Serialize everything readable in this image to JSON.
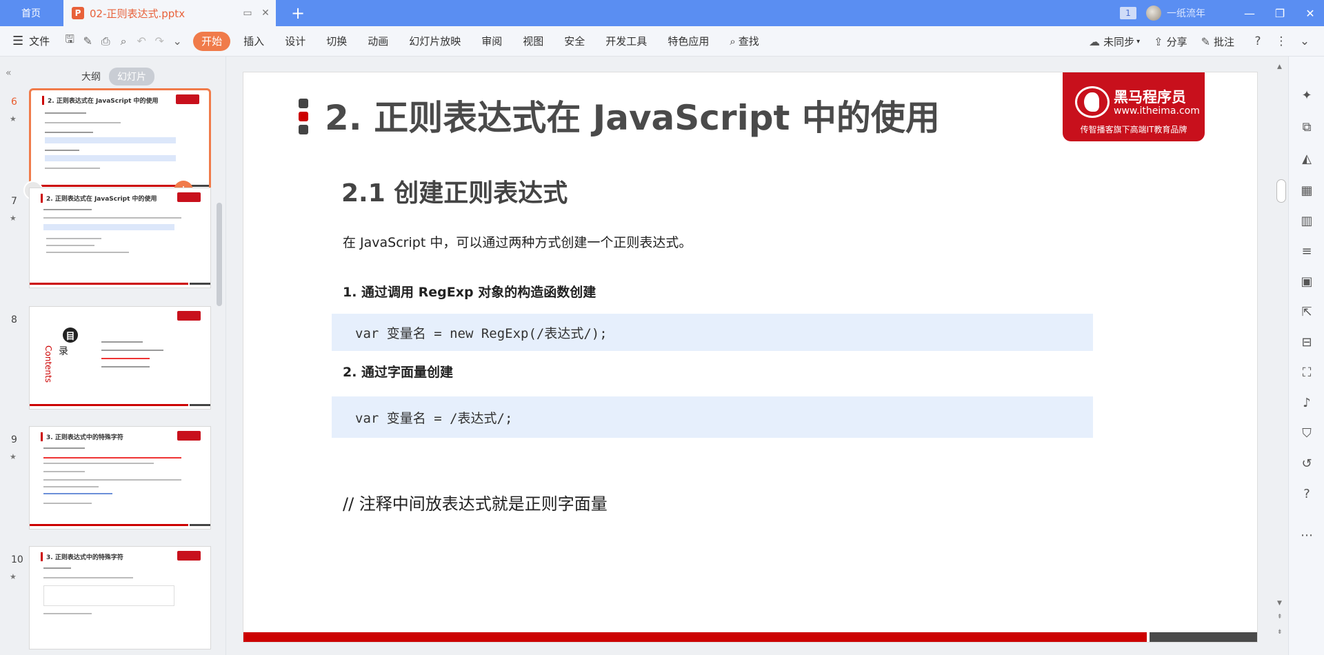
{
  "titlebar": {
    "home_tab": "首页",
    "doc_tab_icon": "P",
    "doc_tab": "02-正则表达式.pptx",
    "page_badge": "1",
    "user_name": "一纸流年"
  },
  "ribbon": {
    "file_label": "文件",
    "tabs": [
      "开始",
      "插入",
      "设计",
      "切换",
      "动画",
      "幻灯片放映",
      "审阅",
      "视图",
      "安全",
      "开发工具",
      "特色应用"
    ],
    "search_label": "查找",
    "sync_label": "未同步",
    "share_label": "分享",
    "comment_label": "批注"
  },
  "panel": {
    "outline_label": "大纲",
    "slides_label": "幻灯片",
    "thumbnails": [
      {
        "num": "6",
        "title": "2. 正则表达式在 JavaScript 中的使用"
      },
      {
        "num": "7",
        "title": "2. 正则表达式在 JavaScript 中的使用"
      },
      {
        "num": "8",
        "title": ""
      },
      {
        "num": "9",
        "title": "3. 正则表达式中的特殊字符"
      },
      {
        "num": "10",
        "title": "3. 正则表达式中的特殊字符"
      }
    ],
    "toc_title_char": "目",
    "toc_sub_char": "录",
    "toc_contents": "Contents"
  },
  "slide": {
    "title": "2. 正则表达式在 JavaScript 中的使用",
    "brand_name": "黑马程序员",
    "brand_url": "www.itheima.com",
    "brand_slogan": "传智播客旗下高端IT教育品牌",
    "subtitle": "2.1 创建正则表达式",
    "intro": "在 JavaScript 中，可以通过两种方式创建一个正则表达式。",
    "section1": "1. 通过调用 RegExp 对象的构造函数创建",
    "code1": "var 变量名 = new RegExp(/表达式/);",
    "section2": "2. 通过字面量创建",
    "code2": "var 变量名 = /表达式/;",
    "comment": "// 注释中间放表达式就是正则字面量"
  },
  "colors": {
    "titlebar": "#5a8ef2",
    "accent": "#f07b4a",
    "brand_red": "#c8101c",
    "code_bg": "#e6effc"
  }
}
